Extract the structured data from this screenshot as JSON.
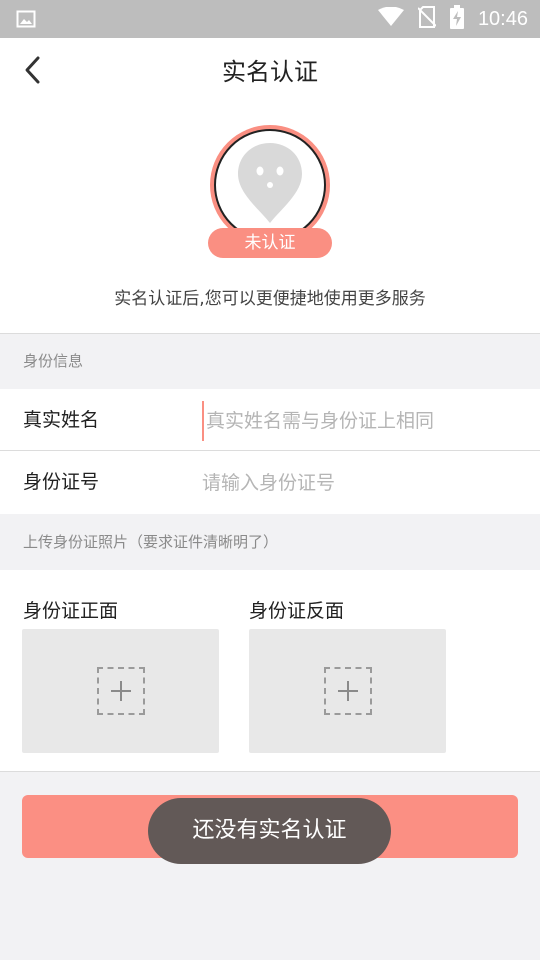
{
  "status_bar": {
    "time": "10:46",
    "icons": [
      "image-icon",
      "wifi-icon",
      "no-sim-icon",
      "battery-charging-icon"
    ]
  },
  "header": {
    "title": "实名认证",
    "back_icon": "chevron-left-icon"
  },
  "profile": {
    "badge": "未认证",
    "description": "实名认证后,您可以更便捷地使用更多服务",
    "avatar_icon": "location-pin-face-icon"
  },
  "identity_section": {
    "label": "身份信息",
    "name_field": {
      "label": "真实姓名",
      "placeholder": "真实姓名需与身份证上相同",
      "value": ""
    },
    "id_field": {
      "label": "身份证号",
      "placeholder": "请输入身份证号",
      "value": ""
    }
  },
  "upload_section": {
    "label": "上传身份证照片（要求证件清晰明了）",
    "front_label": "身份证正面",
    "back_label": "身份证反面",
    "add_icon": "plus-icon"
  },
  "submit": {
    "label": ""
  },
  "toast": {
    "message": "还没有实名认证"
  },
  "colors": {
    "accent": "#fa8f82",
    "status_bar": "#bdbdbd",
    "toast_bg": "#625957",
    "page_bg": "#f2f2f4"
  }
}
